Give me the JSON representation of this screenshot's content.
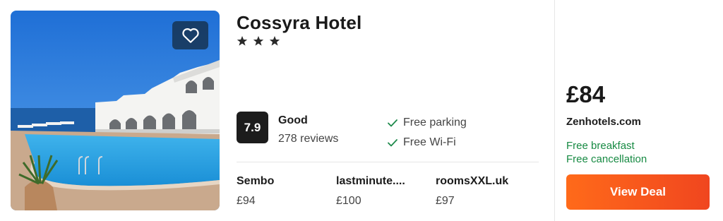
{
  "hotel": {
    "name": "Cossyra Hotel",
    "star_count": 3,
    "star_glyph": "★"
  },
  "rating": {
    "score": "7.9",
    "label": "Good",
    "reviews": "278 reviews"
  },
  "amenities": [
    {
      "label": "Free parking",
      "icon": "check-icon"
    },
    {
      "label": "Free Wi-Fi",
      "icon": "check-icon"
    }
  ],
  "providers": [
    {
      "name": "Sembo",
      "price": "£94"
    },
    {
      "name": "lastminute....",
      "price": "£100"
    },
    {
      "name": "roomsXXL.uk",
      "price": "£97"
    }
  ],
  "deal": {
    "price": "£84",
    "site": "Zenhotels.com",
    "perks": [
      "Free breakfast",
      "Free cancellation"
    ],
    "button_label": "View Deal"
  },
  "icons": {
    "favorite": "heart-outline-icon",
    "star": "star-icon",
    "check": "check-icon"
  },
  "colors": {
    "accent": "#ff5a1f",
    "perk_green": "#178a43",
    "check_green": "#1f8a4c",
    "score_bg": "#1c1c1c"
  }
}
